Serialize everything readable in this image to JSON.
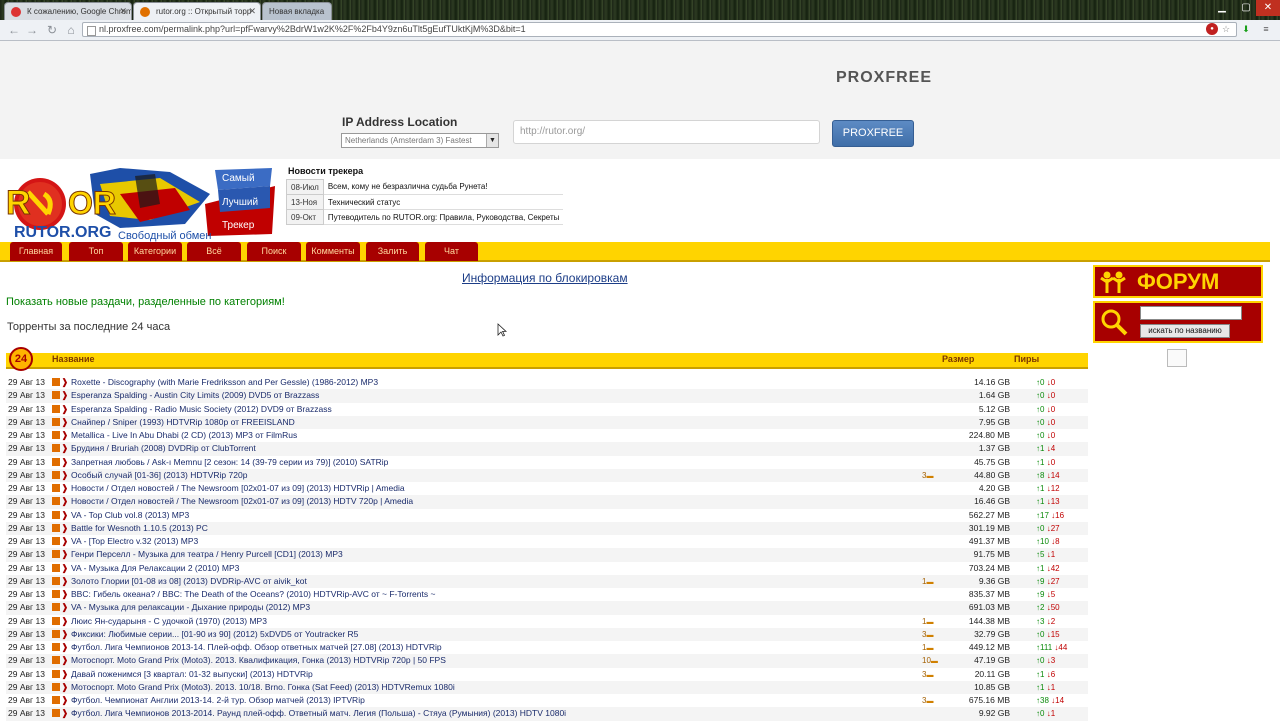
{
  "browser": {
    "tabs": [
      {
        "label": "К сожалению, Google Chrome",
        "active": false
      },
      {
        "label": "rutor.org :: Открытый торр",
        "active": true
      },
      {
        "label": "Новая вкладка",
        "active": false
      }
    ],
    "url": "nl.proxfree.com/permalink.php?url=pfFwarvy%2BdrW1w2K%2F%2Fb4Y9zn6uTlt5gEufTUktKjM%3D&bit=1"
  },
  "proxy": {
    "logo": "PROXFREE",
    "ip_label": "IP Address Location",
    "ip_selected": "Netherlands (Amsterdam 3) Fastest",
    "url_value": "http://rutor.org/",
    "button": "PROXFREE"
  },
  "rutor": {
    "logo_text": "RUTOR.ORG",
    "slogan": "Свободный обмен",
    "slogan_words": [
      "Самый",
      "Лучший",
      "Трекер"
    ],
    "news_title": "Новости трекера",
    "news": [
      {
        "date": "08-Июл",
        "text": "Всем, кому не безразлична судьба Рунета!"
      },
      {
        "date": "13-Ноя",
        "text": "Технический статус"
      },
      {
        "date": "09-Окт",
        "text": "Путеводитель по RUTOR.org: Правила, Руководства, Секреты"
      }
    ],
    "nav": [
      "Главная",
      "Топ",
      "Категории",
      "Всё",
      "Поиск",
      "Комменты",
      "Залить",
      "Чат"
    ]
  },
  "content": {
    "block_link": "Информация по блокировкам",
    "new_categories": "Показать новые раздачи, разделенные по категориям!",
    "last24": "Торренты за последние 24 часа",
    "badge": "24",
    "headers": {
      "name": "Название",
      "size": "Размер",
      "peers": "Пиры"
    },
    "rows": [
      {
        "date": "29 Авг 13",
        "name": "Roxette - Discography (with Marie Fredriksson and Per Gessle) (1986-2012) MP3",
        "comments": "",
        "size": "14.16 GB",
        "up": "0",
        "down": "0"
      },
      {
        "date": "29 Авг 13",
        "name": "Esperanza Spalding - Austin City Limits (2009) DVD5 от Brazzass",
        "comments": "",
        "size": "1.64 GB",
        "up": "0",
        "down": "0"
      },
      {
        "date": "29 Авг 13",
        "name": "Esperanza Spalding - Radio Music Society (2012) DVD9 от Brazzass",
        "comments": "",
        "size": "5.12 GB",
        "up": "0",
        "down": "0"
      },
      {
        "date": "29 Авг 13",
        "name": "Снайпер / Sniper (1993) HDTVRip 1080p от FREEISLAND",
        "comments": "",
        "size": "7.95 GB",
        "up": "0",
        "down": "0"
      },
      {
        "date": "29 Авг 13",
        "name": "Metallica - Live In Abu Dhabi (2 CD) (2013) MP3 от FilmRus",
        "comments": "",
        "size": "224.80 MB",
        "up": "0",
        "down": "0"
      },
      {
        "date": "29 Авг 13",
        "name": "Брудиня / Bruriah (2008) DVDRip от ClubTorrent",
        "comments": "",
        "size": "1.37 GB",
        "up": "1",
        "down": "4"
      },
      {
        "date": "29 Авг 13",
        "name": "Запретная любовь / Ask-ı Memnu [2 сезон: 14 (39-79 серии из 79)] (2010) SATRip",
        "comments": "",
        "size": "45.75 GB",
        "up": "1",
        "down": "0"
      },
      {
        "date": "29 Авг 13",
        "name": "Особый случай [01-36] (2013) HDTVRip 720p",
        "comments": "3",
        "size": "44.80 GB",
        "up": "8",
        "down": "14"
      },
      {
        "date": "29 Авг 13",
        "name": "Новости / Отдел новостей / The Newsroom [02x01-07 из 09] (2013) HDTVRip | Amedia",
        "comments": "",
        "size": "4.20 GB",
        "up": "1",
        "down": "12"
      },
      {
        "date": "29 Авг 13",
        "name": "Новости / Отдел новостей / The Newsroom [02x01-07 из 09] (2013) HDTV 720p | Amedia",
        "comments": "",
        "size": "16.46 GB",
        "up": "1",
        "down": "13"
      },
      {
        "date": "29 Авг 13",
        "name": "VA - Top Club vol.8 (2013) MP3",
        "comments": "",
        "size": "562.27 MB",
        "up": "17",
        "down": "16"
      },
      {
        "date": "29 Авг 13",
        "name": "Battle for Wesnoth 1.10.5 (2013) PC",
        "comments": "",
        "size": "301.19 MB",
        "up": "0",
        "down": "27"
      },
      {
        "date": "29 Авг 13",
        "name": "VA - [Top Electro v.32 (2013) MP3",
        "comments": "",
        "size": "491.37 MB",
        "up": "10",
        "down": "8"
      },
      {
        "date": "29 Авг 13",
        "name": "Генри Перселл - Музыка для театра / Henry Purcell [CD1] (2013) MP3",
        "comments": "",
        "size": "91.75 MB",
        "up": "5",
        "down": "1"
      },
      {
        "date": "29 Авг 13",
        "name": "VA - Музыка Для Релаксации 2 (2010) MP3",
        "comments": "",
        "size": "703.24 MB",
        "up": "1",
        "down": "42"
      },
      {
        "date": "29 Авг 13",
        "name": "Золото Глории [01-08 из 08] (2013) DVDRip-AVC от aivik_kot",
        "comments": "1",
        "size": "9.36 GB",
        "up": "9",
        "down": "27"
      },
      {
        "date": "29 Авг 13",
        "name": "BBC: Гибель океана? / BBC: The Death of the Oceans? (2010) HDTVRip-AVC от ~ F-Torrents ~",
        "comments": "",
        "size": "835.37 MB",
        "up": "9",
        "down": "5"
      },
      {
        "date": "29 Авг 13",
        "name": "VA - Музыка для релаксации - Дыхание природы (2012) MP3",
        "comments": "",
        "size": "691.03 MB",
        "up": "2",
        "down": "50"
      },
      {
        "date": "29 Авг 13",
        "name": "Люис Ян-сударыня - С удочкой (1970) (2013) MP3",
        "comments": "1",
        "size": "144.38 MB",
        "up": "3",
        "down": "2"
      },
      {
        "date": "29 Авг 13",
        "name": "Фиксики: Любимые серии... [01-90 из 90] (2012) 5xDVD5 от Youtracker R5",
        "comments": "3",
        "size": "32.79 GB",
        "up": "0",
        "down": "15"
      },
      {
        "date": "29 Авг 13",
        "name": "Футбол. Лига Чемпионов 2013-14. Плей-офф. Обзор ответных матчей [27.08] (2013) HDTVRip",
        "comments": "1",
        "size": "449.12 MB",
        "up": "111",
        "down": "44"
      },
      {
        "date": "29 Авг 13",
        "name": "Мотоспорт. Moto Grand Prix (Moto3). 2013. Квалификация, Гонка (2013) HDTVRip 720p | 50 FPS",
        "comments": "10",
        "size": "47.19 GB",
        "up": "0",
        "down": "3"
      },
      {
        "date": "29 Авг 13",
        "name": "Давай поженимся [3 квартал: 01-32 выпуски] (2013) HDTVRip",
        "comments": "3",
        "size": "20.11 GB",
        "up": "1",
        "down": "6"
      },
      {
        "date": "29 Авг 13",
        "name": "Мотоспорт. Moto Grand Prix (Moto3). 2013. 10/18. Brno. Гонка (Sat Feed) (2013) HDTVRemux 1080i",
        "comments": "",
        "size": "10.85 GB",
        "up": "1",
        "down": "1"
      },
      {
        "date": "29 Авг 13",
        "name": "Футбол. Чемпионат Англии 2013-14. 2-й тур. Обзор матчей (2013) IPTVRip",
        "comments": "3",
        "size": "675.16 MB",
        "up": "38",
        "down": "14"
      },
      {
        "date": "29 Авг 13",
        "name": "Футбол. Лига Чемпионов 2013-2014. Раунд плей-офф. Ответный матч. Легия (Польша) - Стяуа (Румыния) (2013) HDTV 1080i",
        "comments": "",
        "size": "9.92 GB",
        "up": "0",
        "down": "1"
      }
    ]
  },
  "sidebar": {
    "forum": "ФОРУМ",
    "search_button": "искать по названию"
  }
}
